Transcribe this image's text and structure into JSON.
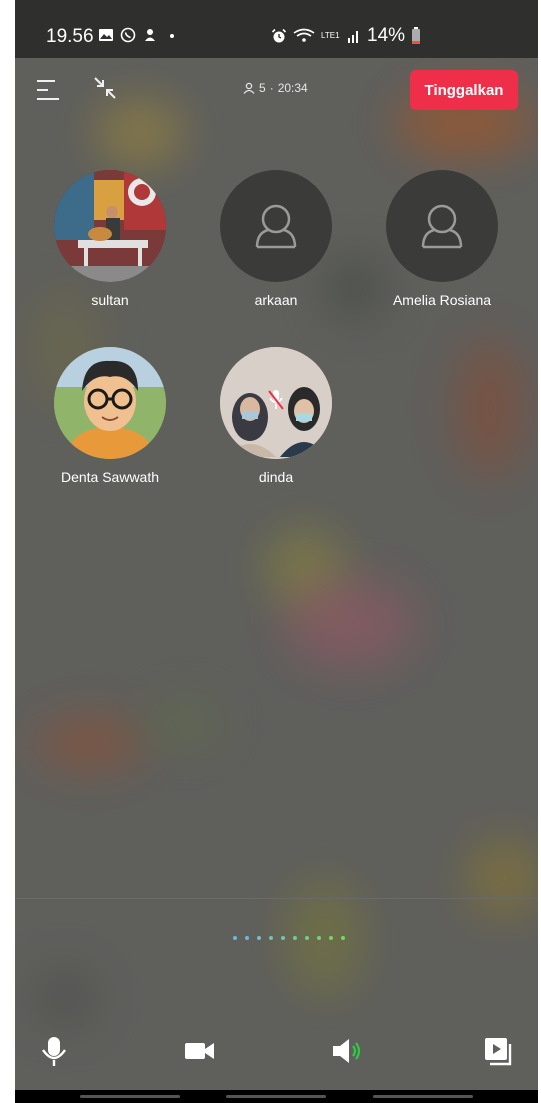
{
  "status_bar": {
    "time": "19.56",
    "battery": "14%",
    "network": "LTE1"
  },
  "header": {
    "participants_count": "5",
    "timer": "20:34",
    "leave_label": "Tinggalkan"
  },
  "members": [
    {
      "name": "sultan",
      "avatar": "photo-guitar"
    },
    {
      "name": "arkaan",
      "avatar": "default-person-icon"
    },
    {
      "name": "Amelia Rosiana",
      "avatar": "default-person-icon"
    },
    {
      "name": "Denta Sawwath",
      "avatar": "photo-cartoon-boy"
    },
    {
      "name": "dinda",
      "avatar": "photo-two-girls",
      "muted": true
    }
  ],
  "controls": {
    "mic": "microphone-icon",
    "video": "video-camera-icon",
    "speaker": "speaker-icon",
    "share": "screen-share-icon"
  },
  "colors": {
    "leave_button": "#ef2f4a",
    "background": "#5f5f5c",
    "speaker_active": "#2ecc40"
  }
}
